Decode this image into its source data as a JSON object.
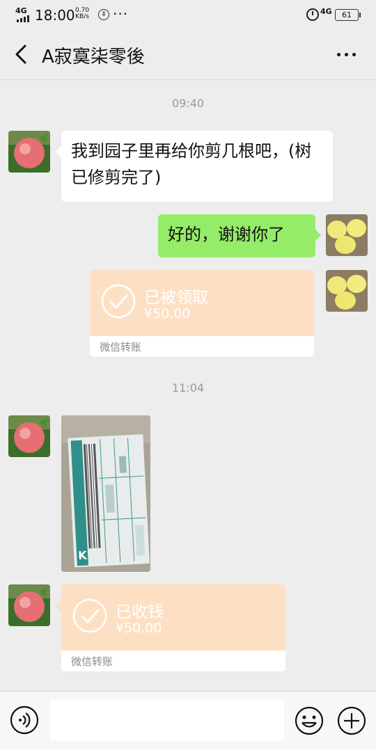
{
  "status_bar": {
    "network": "4G",
    "time": "18:00",
    "speed_value": "0.70",
    "speed_unit": "KB/s",
    "more": "···",
    "network_right": "4G",
    "battery": "61"
  },
  "header": {
    "title": "A寂寞柒零後",
    "back_icon": "chevron-left-icon",
    "more_icon": "more-dots-icon"
  },
  "messages": {
    "time1": "09:40",
    "msg1_text": "我到园子里再给你剪几根吧，(树已修剪完了)",
    "msg2_text": "好的，谢谢你了",
    "transfer1": {
      "status": "已被领取",
      "amount": "¥50.00",
      "footer": "微信转账"
    },
    "time2": "11:04",
    "transfer2": {
      "status": "已收钱",
      "amount": "¥50.00",
      "footer": "微信转账"
    }
  },
  "input_bar": {
    "placeholder": "",
    "voice_icon": "voice-icon",
    "emoji_icon": "emoji-icon",
    "plus_icon": "plus-icon"
  },
  "colors": {
    "background": "#ededed",
    "outgoing_bubble": "#95ec69",
    "incoming_bubble": "#ffffff",
    "transfer_card": "#fde0c4"
  }
}
